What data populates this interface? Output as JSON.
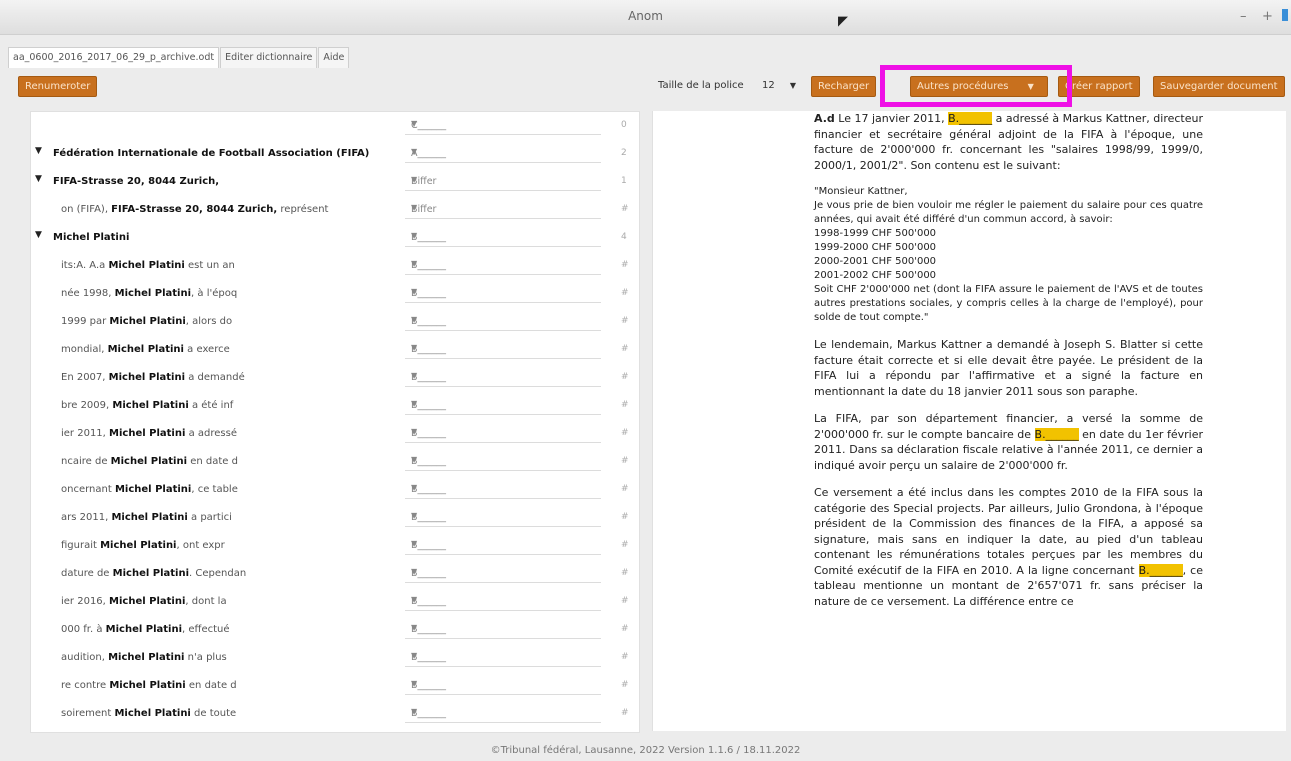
{
  "window": {
    "title": "Anom",
    "min": "–",
    "max": "+"
  },
  "tabs": [
    {
      "label": "aa_0600_2016_2017_06_29_p_archive.odt"
    },
    {
      "label": "Editer dictionnaire"
    },
    {
      "label": "Aide"
    }
  ],
  "toolbar": {
    "renumeroter": "Renumeroter",
    "font_label": "Taille de la police",
    "font_size": "12",
    "recharger": "Recharger",
    "autres": "Autres procédures",
    "rapport": "Créer rapport",
    "sauvegarder": "Sauvegarder document"
  },
  "left": {
    "rows": [
      {
        "pre": "",
        "name": "",
        "post": "",
        "value": "C______",
        "count": "0",
        "tri": false,
        "bold": false
      },
      {
        "pre": "",
        "name": "Fédération Internationale de Football Association (FIFA)",
        "post": "",
        "value": "A______",
        "count": "2",
        "tri": true,
        "bold": true
      },
      {
        "pre": "",
        "name": "FIFA-Strasse 20, 8044 Zurich,",
        "post": "",
        "value": "Biffer",
        "count": "1",
        "tri": true,
        "bold": true
      },
      {
        "pre": "on (FIFA), ",
        "name": "FIFA-Strasse 20, 8044 Zurich,",
        "post": " représent",
        "value": "Biffer",
        "count": "#",
        "tri": false,
        "bold": false
      },
      {
        "pre": "",
        "name": "Michel Platini",
        "post": "",
        "value": "B______",
        "count": "4",
        "tri": true,
        "bold": true
      },
      {
        "pre": "its:A. A.a ",
        "name": "Michel Platini",
        "post": " est un an",
        "value": "B______",
        "count": "#",
        "tri": false,
        "bold": false
      },
      {
        "pre": "née 1998, ",
        "name": "Michel Platini",
        "post": ", à l'époq",
        "value": "B______",
        "count": "#",
        "tri": false,
        "bold": false
      },
      {
        "pre": "1999 par ",
        "name": "Michel Platini",
        "post": ", alors do",
        "value": "B______",
        "count": "#",
        "tri": false,
        "bold": false
      },
      {
        "pre": "mondial, ",
        "name": "Michel Platini",
        "post": " a exerce",
        "value": "B______",
        "count": "#",
        "tri": false,
        "bold": false
      },
      {
        "pre": "En 2007, ",
        "name": "Michel Platini",
        "post": " a demandé",
        "value": "B______",
        "count": "#",
        "tri": false,
        "bold": false
      },
      {
        "pre": "bre 2009, ",
        "name": "Michel Platini",
        "post": " a été inf",
        "value": "B______",
        "count": "#",
        "tri": false,
        "bold": false
      },
      {
        "pre": "ier 2011, ",
        "name": "Michel Platini",
        "post": " a adressé",
        "value": "B______",
        "count": "#",
        "tri": false,
        "bold": false
      },
      {
        "pre": "ncaire de ",
        "name": "Michel Platini",
        "post": " en date d",
        "value": "B______",
        "count": "#",
        "tri": false,
        "bold": false
      },
      {
        "pre": "oncernant ",
        "name": "Michel Platini",
        "post": ", ce table",
        "value": "B______",
        "count": "#",
        "tri": false,
        "bold": false
      },
      {
        "pre": "ars 2011, ",
        "name": "Michel Platini",
        "post": " a partici",
        "value": "B______",
        "count": "#",
        "tri": false,
        "bold": false
      },
      {
        "pre": "figurait ",
        "name": "Michel Platini",
        "post": ", ont expr",
        "value": "B______",
        "count": "#",
        "tri": false,
        "bold": false
      },
      {
        "pre": "dature de ",
        "name": "Michel Platini",
        "post": ". Cependan",
        "value": "B______",
        "count": "#",
        "tri": false,
        "bold": false
      },
      {
        "pre": "ier 2016, ",
        "name": "Michel Platini",
        "post": ", dont la",
        "value": "B______",
        "count": "#",
        "tri": false,
        "bold": false
      },
      {
        "pre": "000 fr. à ",
        "name": "Michel Platini",
        "post": ", effectué",
        "value": "B______",
        "count": "#",
        "tri": false,
        "bold": false
      },
      {
        "pre": "audition, ",
        "name": "Michel Platini",
        "post": " n'a plus",
        "value": "B______",
        "count": "#",
        "tri": false,
        "bold": false
      },
      {
        "pre": "re contre ",
        "name": "Michel Platini",
        "post": " en date d",
        "value": "B______",
        "count": "#",
        "tri": false,
        "bold": false
      },
      {
        "pre": "soirement ",
        "name": "Michel Platini",
        "post": " de toute",
        "value": "B______",
        "count": "#",
        "tri": false,
        "bold": false
      }
    ]
  },
  "doc": {
    "p1": {
      "label": "A.d",
      "t1": " Le 17 janvier 2011, ",
      "mark": "B.______",
      "t2": " a adressé à Markus Kattner, directeur financier et secrétaire général adjoint de la FIFA à l'époque, une facture de 2'000'000 fr. concernant les \"salaires 1998/99, 1999/0, 2000/1, 2001/2\". Son contenu est le suivant:"
    },
    "letter": [
      "\"Monsieur Kattner,",
      "Je vous prie de bien vouloir me régler le paiement du salaire pour ces quatre années, qui avait été différé d'un commun accord, à savoir:",
      "1998-1999 CHF 500'000",
      "1999-2000 CHF 500'000",
      "2000-2001 CHF 500'000",
      "2001-2002 CHF 500'000",
      "Soit CHF 2'000'000 net (dont la FIFA assure le paiement de l'AVS et de toutes autres prestations sociales, y compris celles à la charge de l'employé), pour solde de tout compte.\""
    ],
    "p2": "Le lendemain, Markus Kattner a demandé à Joseph S. Blatter si cette facture était correcte et si elle devait être payée. Le président de la FIFA lui a répondu par l'affirmative et a signé la facture en mentionnant la date du 18 janvier 2011 sous son paraphe.",
    "p3": {
      "t1": "La FIFA, par son département financier, a versé la somme de 2'000'000 fr. sur le compte bancaire de ",
      "mark": "B.______",
      "t2": " en date du 1er février 2011. Dans sa déclaration fiscale relative à l'année 2011, ce dernier a indiqué avoir perçu un salaire de 2'000'000 fr."
    },
    "p4": {
      "t1": "Ce versement a été inclus dans les comptes 2010 de la FIFA sous la catégorie des Special projects. Par ailleurs, Julio Grondona, à l'époque président de la Commission des finances de la FIFA, a apposé sa signature, mais sans en indiquer la date, au pied d'un tableau contenant les rémunérations totales perçues par les membres du Comité exécutif de la FIFA en 2010. A la ligne concernant ",
      "mark": "B.______",
      "t2": ", ce tableau mentionne un montant de 2'657'071 fr. sans préciser la nature de ce versement. La différence entre ce"
    }
  },
  "footer": "©Tribunal fédéral, Lausanne, 2022 Version 1.1.6 / 18.11.2022"
}
